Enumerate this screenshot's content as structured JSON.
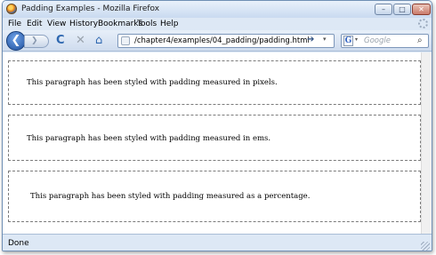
{
  "window": {
    "title": "Padding Examples - Mozilla Firefox",
    "controls": {
      "minimize": "–",
      "maximize": "□",
      "close": "✕"
    }
  },
  "menu": {
    "items": [
      "File",
      "Edit",
      "View",
      "History",
      "Bookmarks",
      "Tools",
      "Help"
    ]
  },
  "navigation": {
    "back_glyph": "❮",
    "forward_glyph": "❯",
    "reload_glyph": "C",
    "stop_glyph": "✕",
    "home_glyph": "⌂",
    "url": "/chapter4/examples/04_padding/padding.html",
    "go_glyph": "➔",
    "dropdown_glyph": "▾",
    "search_engine_glyph": "G",
    "search_placeholder": "Google",
    "search_glyph": "⌕"
  },
  "content": {
    "paragraphs": [
      "This paragraph has been styled with padding measured in pixels.",
      "This paragraph has been styled with padding measured in ems.",
      "This paragraph has been styled with padding measured as a percentage."
    ]
  },
  "status": {
    "text": "Done"
  }
}
